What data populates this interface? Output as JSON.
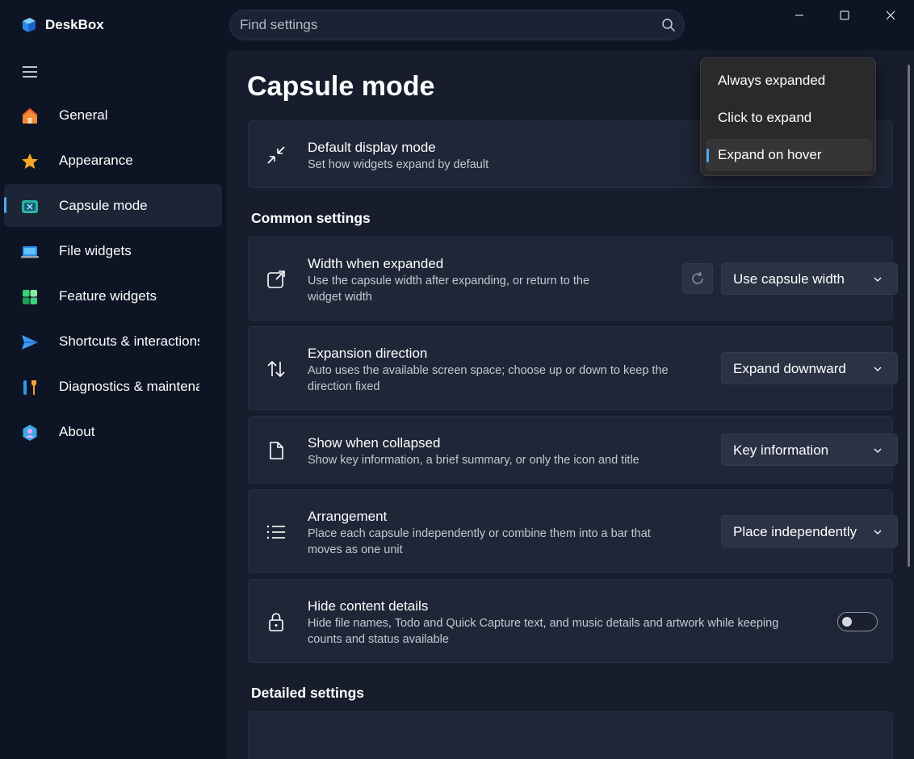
{
  "app": {
    "title": "DeskBox"
  },
  "search": {
    "placeholder": "Find settings"
  },
  "window_controls": [
    "minimize",
    "maximize",
    "close"
  ],
  "sidebar": {
    "items": [
      {
        "label": "General",
        "icon": "home-icon",
        "active": false
      },
      {
        "label": "Appearance",
        "icon": "star-icon",
        "active": false
      },
      {
        "label": "Capsule mode",
        "icon": "capsule-icon",
        "active": true
      },
      {
        "label": "File widgets",
        "icon": "laptop-icon",
        "active": false
      },
      {
        "label": "Feature widgets",
        "icon": "widgets-icon",
        "active": false
      },
      {
        "label": "Shortcuts & interactions",
        "icon": "send-icon",
        "active": false
      },
      {
        "label": "Diagnostics & maintenance",
        "icon": "tools-icon",
        "active": false
      },
      {
        "label": "About",
        "icon": "about-icon",
        "active": false
      }
    ]
  },
  "page": {
    "title": "Capsule mode",
    "default_display": {
      "title": "Default display mode",
      "desc": "Set how widgets expand by default",
      "options": [
        "Always expanded",
        "Click to expand",
        "Expand on hover"
      ],
      "selected": "Expand on hover"
    },
    "common_heading": "Common settings",
    "width": {
      "title": "Width when expanded",
      "desc": "Use the capsule width after expanding, or return to the widget width",
      "value": "Use capsule width"
    },
    "direction": {
      "title": "Expansion direction",
      "desc": "Auto uses the available screen space; choose up or down to keep the direction fixed",
      "value": "Expand downward"
    },
    "collapsed": {
      "title": "Show when collapsed",
      "desc": "Show key information, a brief summary, or only the icon and title",
      "value": "Key information"
    },
    "arrangement": {
      "title": "Arrangement",
      "desc": "Place each capsule independently or combine them into a bar that moves as one unit",
      "value": "Place independently"
    },
    "hide_details": {
      "title": "Hide content details",
      "desc": "Hide file names, Todo and Quick Capture text, and music details and artwork while keeping counts and status available",
      "enabled": false
    },
    "detailed_heading": "Detailed settings"
  },
  "colors": {
    "accent": "#4ea8f2",
    "background": "#0d1423",
    "content": "#171d2c",
    "card": "#1f2637"
  }
}
